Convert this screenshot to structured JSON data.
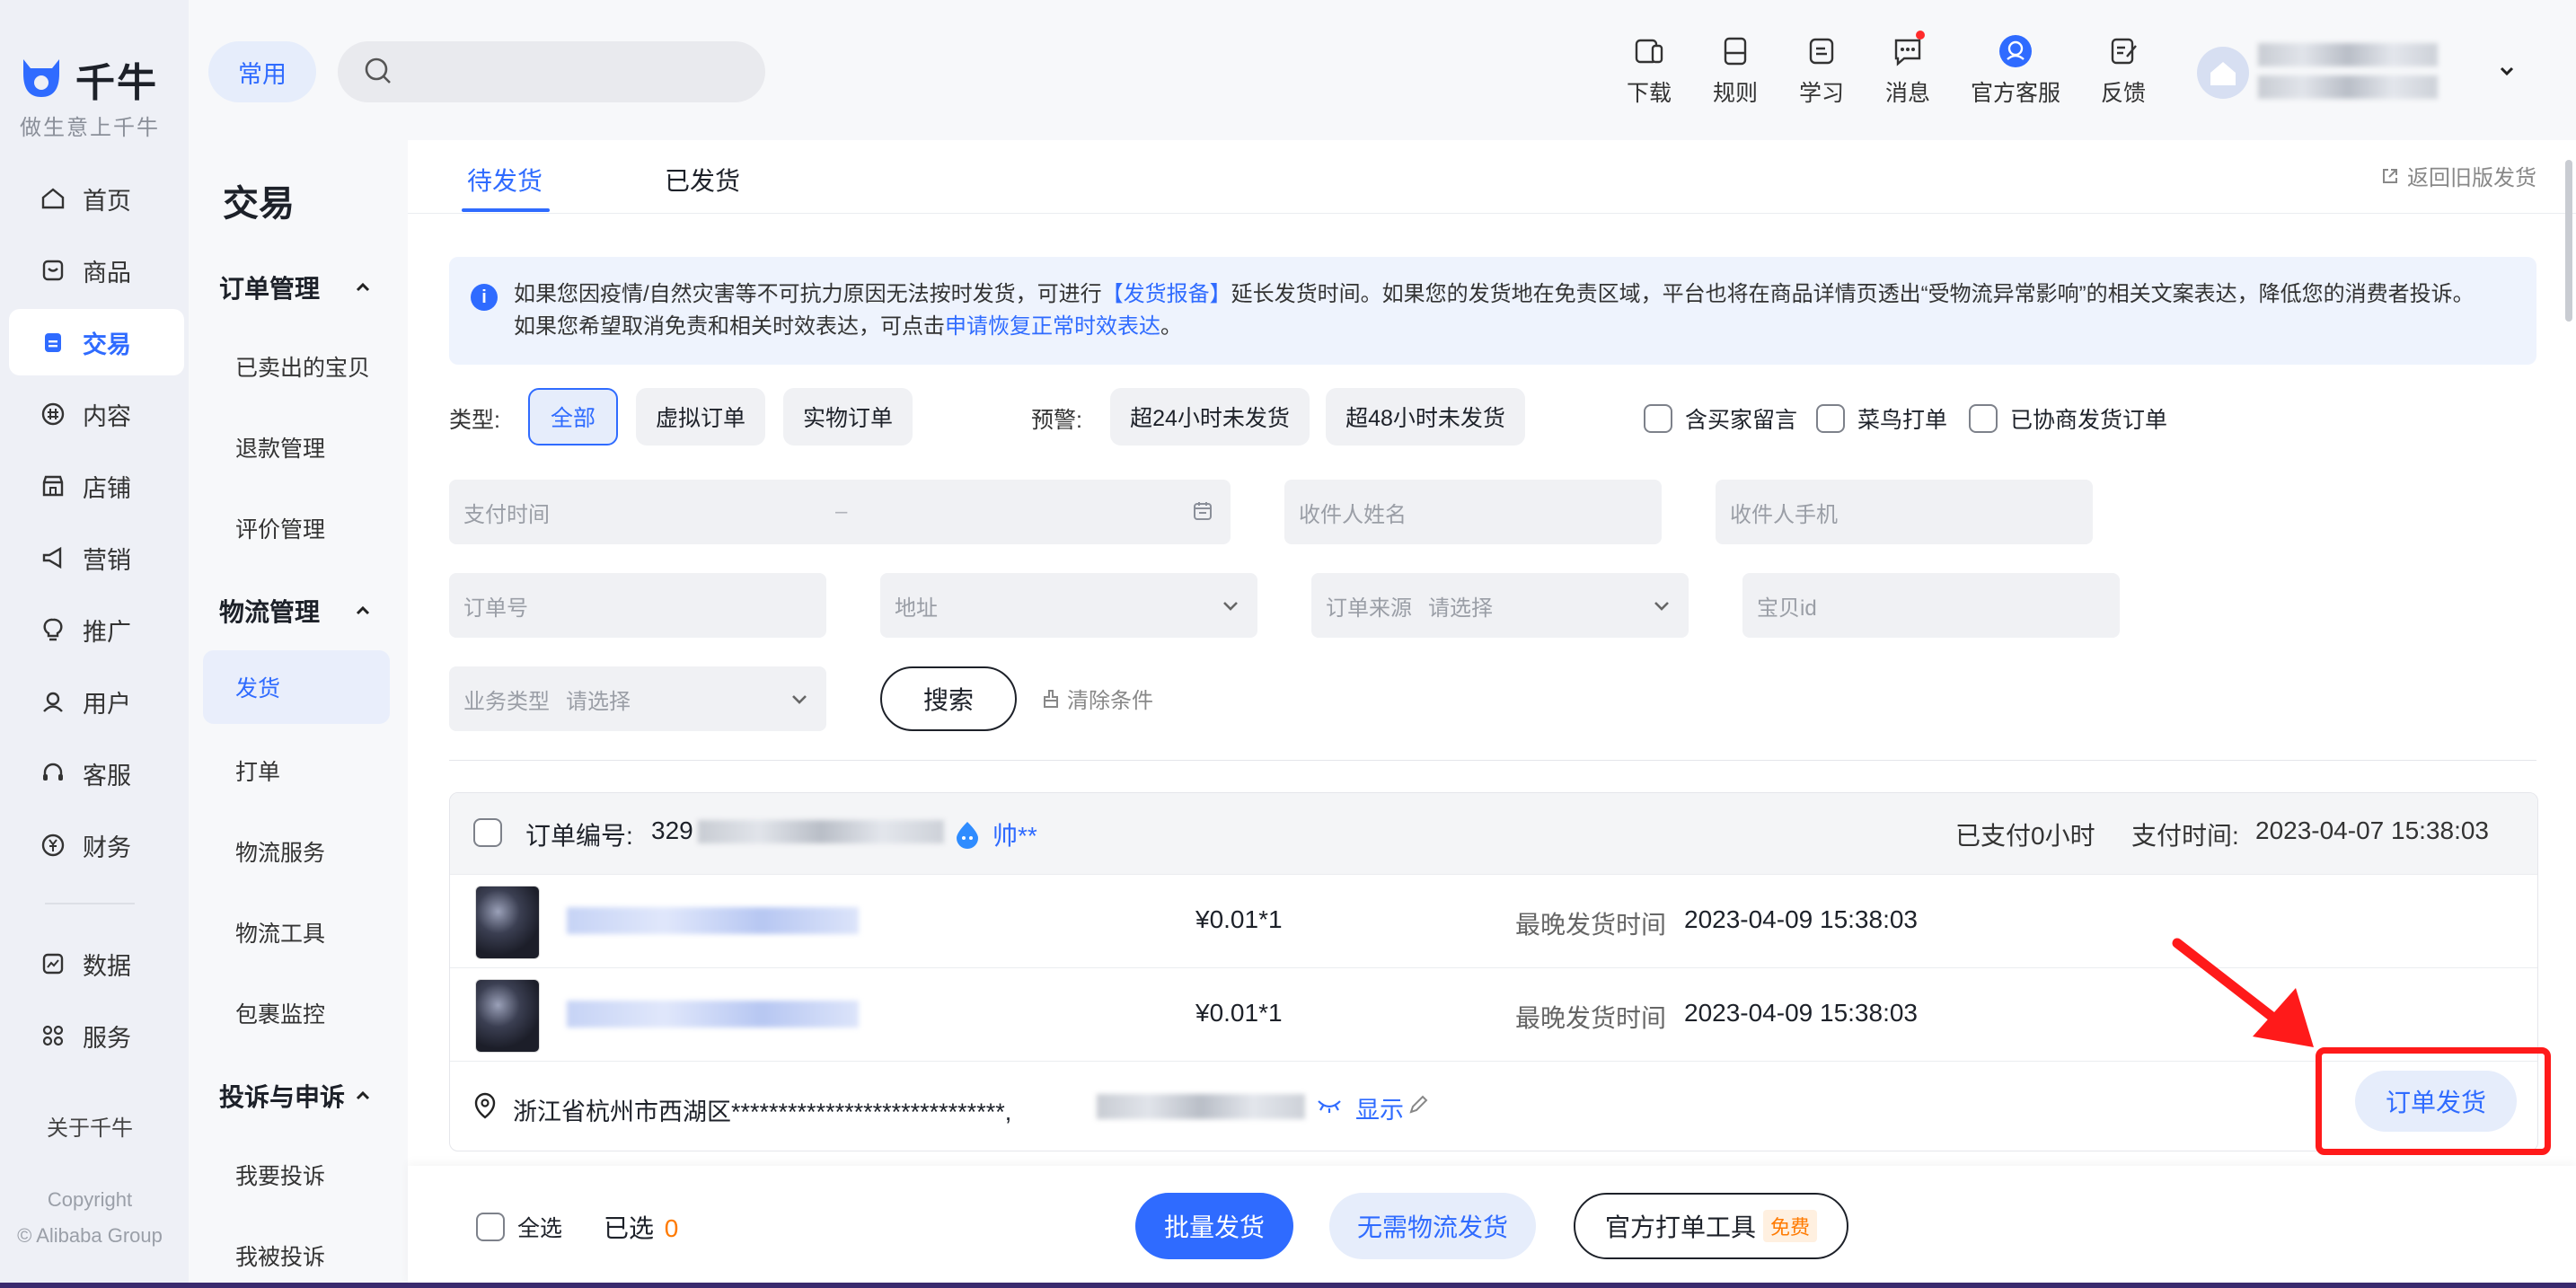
{
  "brand": {
    "name": "千牛",
    "slogan": "做生意上千牛"
  },
  "leftnav": {
    "items": [
      {
        "label": "首页",
        "icon": "home-icon"
      },
      {
        "label": "商品",
        "icon": "goods-icon"
      },
      {
        "label": "交易",
        "icon": "trade-icon",
        "active": true
      },
      {
        "label": "内容",
        "icon": "content-icon"
      },
      {
        "label": "店铺",
        "icon": "shop-icon"
      },
      {
        "label": "营销",
        "icon": "megaphone-icon"
      },
      {
        "label": "推广",
        "icon": "bulb-icon"
      },
      {
        "label": "用户",
        "icon": "user-icon"
      },
      {
        "label": "客服",
        "icon": "headset-icon"
      },
      {
        "label": "财务",
        "icon": "finance-icon"
      }
    ],
    "items2": [
      {
        "label": "数据",
        "icon": "chart-icon"
      },
      {
        "label": "服务",
        "icon": "grid-icon"
      }
    ],
    "about": "关于千牛",
    "copyright1": "Copyright",
    "copyright2": "© Alibaba Group"
  },
  "header": {
    "common_label": "常用",
    "search_placeholder": "",
    "tools": [
      {
        "label": "下载",
        "icon": "download-icon"
      },
      {
        "label": "规则",
        "icon": "rules-icon"
      },
      {
        "label": "学习",
        "icon": "learn-icon"
      },
      {
        "label": "消息",
        "icon": "message-icon",
        "badge": true
      },
      {
        "label": "官方客服",
        "icon": "official-service-icon"
      },
      {
        "label": "反馈",
        "icon": "feedback-icon"
      }
    ]
  },
  "subnav": {
    "title": "交易",
    "group1": "订单管理",
    "group1_items": [
      "已卖出的宝贝",
      "退款管理",
      "评价管理"
    ],
    "group2": "物流管理",
    "group2_active": "发货",
    "group2_items": [
      "打单",
      "物流服务",
      "物流工具",
      "包裹监控"
    ],
    "group3": "投诉与申诉",
    "group3_items": [
      "我要投诉",
      "我被投诉"
    ]
  },
  "tabs": {
    "pending": "待发货",
    "shipped": "已发货",
    "old_version": "返回旧版发货"
  },
  "notice": {
    "p1": "如果您因疫情/自然灾害等不可抗力原因无法按时发货，可进行",
    "link1": "【发货报备】",
    "p2": "延长发货时间。如果您的发货地在免责区域，平台也将在商品详情页透出“受物流异常影响”的相关文案表达，降低您的消费者投诉。",
    "p3": "如果您希望取消免责和相关时效表达，可点击",
    "link2": "申请恢复正常时效表达",
    "p4": "。"
  },
  "filters": {
    "type_label": "类型:",
    "types": [
      "全部",
      "虚拟订单",
      "实物订单"
    ],
    "warn_label": "预警:",
    "warns": [
      "超24小时未发货",
      "超48小时未发货"
    ],
    "checks": [
      "含买家留言",
      "菜鸟打单",
      "已协商发货订单"
    ],
    "pay_time": "支付时间",
    "range_sep": "–",
    "receiver_name": "收件人姓名",
    "receiver_phone": "收件人手机",
    "order_no": "订单号",
    "address": "地址",
    "order_source": "订单来源",
    "select_placeholder": "请选择",
    "item_id": "宝贝id",
    "biz_type": "业务类型",
    "search_btn": "搜索",
    "clear_btn": "清除条件"
  },
  "order": {
    "no_label": "订单编号:",
    "no_prefix": "329",
    "buyer": "帅**",
    "paid_since": "已支付0小时",
    "pay_time_label": "支付时间:",
    "pay_time": "2023-04-07 15:38:03",
    "items": [
      {
        "price": "¥0.01*1",
        "deadline_label": "最晚发货时间",
        "deadline": "2023-04-09 15:38:03"
      },
      {
        "price": "¥0.01*1",
        "deadline_label": "最晚发货时间",
        "deadline": "2023-04-09 15:38:03"
      }
    ],
    "address": "浙江省杭州市西湖区*****************************,",
    "show": "显示",
    "ship_btn": "订单发货"
  },
  "bottom": {
    "select_all": "全选",
    "selected_label": "已选",
    "selected_count": "0",
    "batch_ship": "批量发货",
    "no_logistics": "无需物流发货",
    "print_tool": "官方打单工具",
    "free": "免费"
  },
  "colors": {
    "accent": "#2f6bff",
    "highlight": "#ff1a1a",
    "orange": "#ff7a00"
  }
}
